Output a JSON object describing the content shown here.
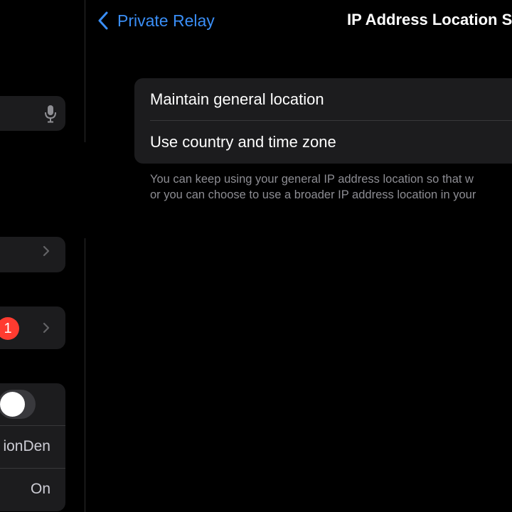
{
  "nav": {
    "back_label": "Private Relay",
    "title": "IP Address Location S"
  },
  "options": [
    {
      "label": "Maintain general location"
    },
    {
      "label": "Use country and time zone"
    }
  ],
  "footnote": {
    "line1": "You can keep using your general IP address location so that w",
    "line2": "or you can choose to use a broader IP address location in your"
  },
  "sidebar": {
    "badge_count": "1",
    "row_text_1": "ionDen",
    "row_text_2": "On"
  },
  "colors": {
    "accent": "#3a8ef6",
    "badge": "#ff3b30",
    "card": "#1c1c1e",
    "background": "#000000"
  }
}
